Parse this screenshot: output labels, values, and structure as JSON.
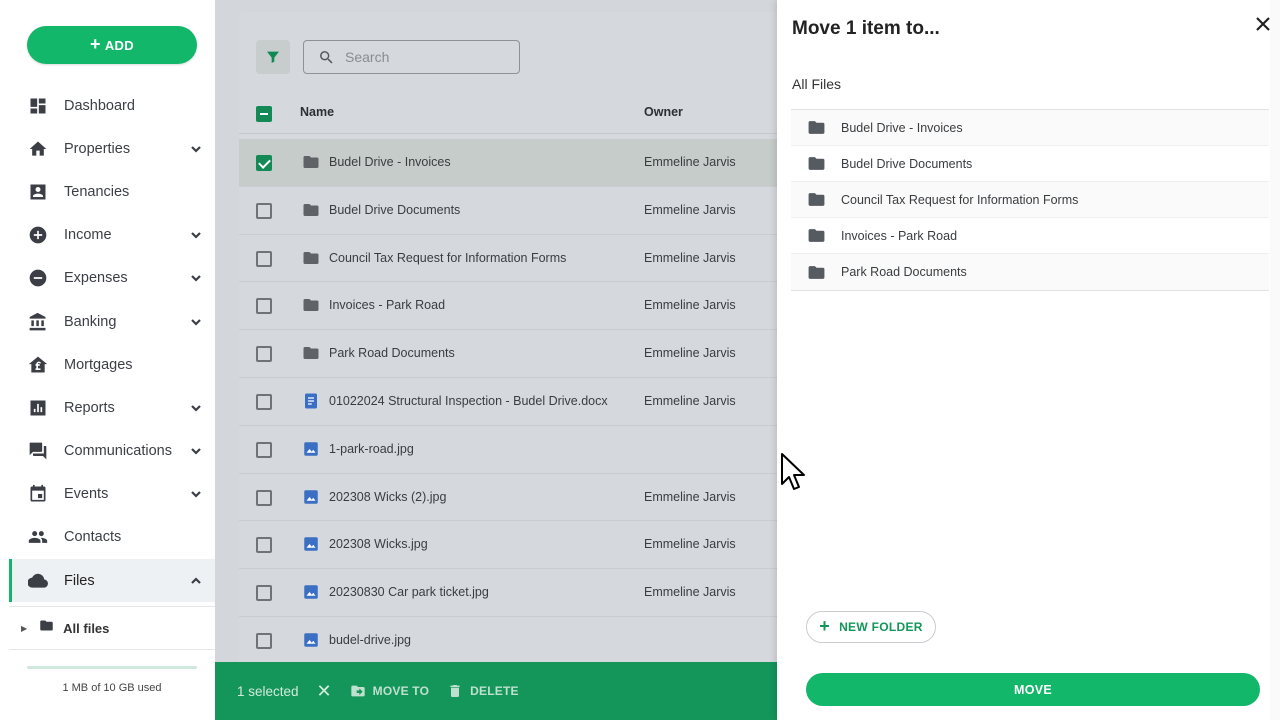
{
  "sidebar": {
    "add_label": "ADD",
    "items": [
      {
        "label": "Dashboard",
        "icon": "dashboard-icon",
        "has_chevron": false
      },
      {
        "label": "Properties",
        "icon": "home-icon",
        "has_chevron": true
      },
      {
        "label": "Tenancies",
        "icon": "contact-card-icon",
        "has_chevron": false
      },
      {
        "label": "Income",
        "icon": "plus-circle-icon",
        "has_chevron": true
      },
      {
        "label": "Expenses",
        "icon": "minus-circle-icon",
        "has_chevron": true
      },
      {
        "label": "Banking",
        "icon": "bank-icon",
        "has_chevron": true
      },
      {
        "label": "Mortgages",
        "icon": "mortgage-house-icon",
        "has_chevron": false
      },
      {
        "label": "Reports",
        "icon": "bar-chart-icon",
        "has_chevron": true
      },
      {
        "label": "Communications",
        "icon": "chat-icon",
        "has_chevron": true
      },
      {
        "label": "Events",
        "icon": "calendar-icon",
        "has_chevron": true
      },
      {
        "label": "Contacts",
        "icon": "people-icon",
        "has_chevron": false
      },
      {
        "label": "Files",
        "icon": "cloud-icon",
        "has_chevron": true,
        "active": true,
        "expanded": true
      }
    ],
    "sub_item": {
      "label": "All files",
      "icon": "folder-icon"
    },
    "storage": {
      "text": "1 MB of 10 GB used",
      "used_fraction": 0.0001
    }
  },
  "main": {
    "search_placeholder": "Search",
    "columns": {
      "name": "Name",
      "owner": "Owner"
    },
    "rows": [
      {
        "name": "Budel Drive - Invoices",
        "owner": "Emmeline Jarvis",
        "type": "folder",
        "selected": true
      },
      {
        "name": "Budel Drive Documents",
        "owner": "Emmeline Jarvis",
        "type": "folder",
        "selected": false
      },
      {
        "name": "Council Tax Request for Information Forms",
        "owner": "Emmeline Jarvis",
        "type": "folder",
        "selected": false
      },
      {
        "name": "Invoices - Park Road",
        "owner": "Emmeline Jarvis",
        "type": "folder",
        "selected": false
      },
      {
        "name": "Park Road Documents",
        "owner": "Emmeline Jarvis",
        "type": "folder",
        "selected": false
      },
      {
        "name": "01022024 Structural Inspection - Budel Drive.docx",
        "owner": "Emmeline Jarvis",
        "type": "doc",
        "selected": false
      },
      {
        "name": "1-park-road.jpg",
        "owner": "",
        "type": "image",
        "selected": false
      },
      {
        "name": "202308 Wicks (2).jpg",
        "owner": "Emmeline Jarvis",
        "type": "image",
        "selected": false
      },
      {
        "name": "202308 Wicks.jpg",
        "owner": "Emmeline Jarvis",
        "type": "image",
        "selected": false
      },
      {
        "name": "20230830 Car park ticket.jpg",
        "owner": "Emmeline Jarvis",
        "type": "image",
        "selected": false
      },
      {
        "name": "budel-drive.jpg",
        "owner": "",
        "type": "image",
        "selected": false
      }
    ],
    "action_bar": {
      "selected_text": "1 selected",
      "move_to_label": "MOVE TO",
      "delete_label": "DELETE"
    }
  },
  "move_panel": {
    "title": "Move 1 item to...",
    "breadcrumb": "All Files",
    "folders": [
      "Budel Drive - Invoices",
      "Budel Drive Documents",
      "Council Tax Request for Information Forms",
      "Invoices - Park Road",
      "Park Road Documents"
    ],
    "new_folder_label": "NEW FOLDER",
    "move_label": "MOVE"
  },
  "colors": {
    "brand_green": "#12b76a",
    "action_bar_green": "#14955a",
    "checkbox_green": "#138a55"
  }
}
